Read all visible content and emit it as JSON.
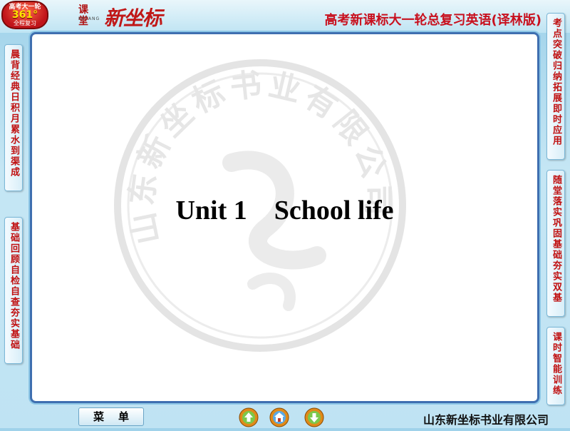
{
  "badge": {
    "line1": "高考大一轮",
    "line2": "361°",
    "line3": "全程复习"
  },
  "brand": {
    "small": "课堂",
    "small_sub": "KETANG",
    "big": "新坐标"
  },
  "header": {
    "course_title": "高考新课标大一轮总复习英语(译林版)"
  },
  "left_tabs": [
    {
      "label": "晨背经典日积月累水到渠成"
    },
    {
      "label": "基础回顾自检自查夯实基础"
    }
  ],
  "right_tabs": [
    {
      "label": "考点突破归纳拓展即时应用"
    },
    {
      "label": "随堂落实巩固基础夯实双基"
    },
    {
      "label": "课时智能训练"
    }
  ],
  "slide": {
    "title": "Unit 1    School life"
  },
  "watermark": {
    "text": "山东新坐标书业有限公司"
  },
  "footer": {
    "menu_label": "菜单",
    "company": "山东新坐标书业有限公司"
  },
  "icons": {
    "prev": "prev-arrow-icon",
    "home": "home-icon",
    "next": "next-arrow-icon"
  }
}
